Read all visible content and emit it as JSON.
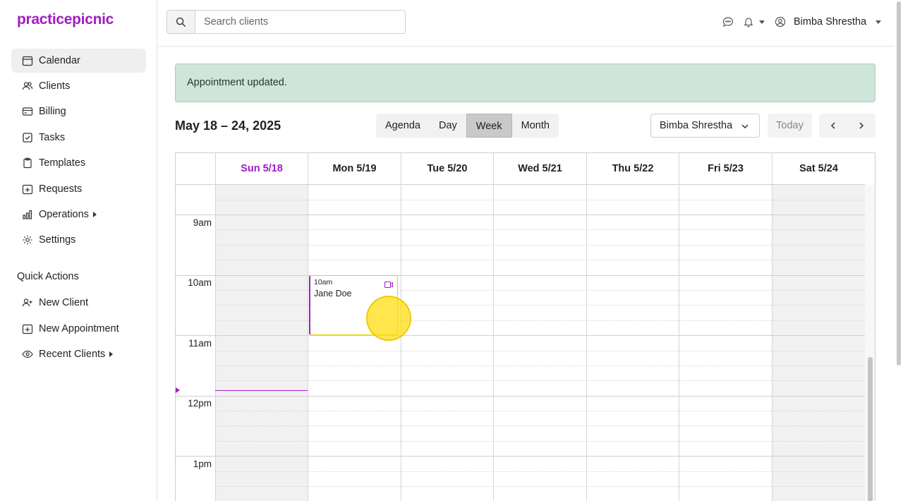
{
  "app": {
    "logo": "practicepicnic",
    "accent_color": "#a21cc2"
  },
  "sidebar": {
    "items": [
      {
        "label": "Calendar",
        "icon": "calendar-icon",
        "active": true
      },
      {
        "label": "Clients",
        "icon": "users-icon"
      },
      {
        "label": "Billing",
        "icon": "credit-card-icon"
      },
      {
        "label": "Tasks",
        "icon": "checkbox-icon"
      },
      {
        "label": "Templates",
        "icon": "clipboard-icon"
      },
      {
        "label": "Requests",
        "icon": "calendar-plus-icon"
      },
      {
        "label": "Operations",
        "icon": "bar-chart-icon",
        "expandable": true
      },
      {
        "label": "Settings",
        "icon": "gear-icon"
      }
    ],
    "quick_actions_title": "Quick Actions",
    "quick_actions": [
      {
        "label": "New Client",
        "icon": "user-plus-icon"
      },
      {
        "label": "New Appointment",
        "icon": "calendar-plus-icon"
      },
      {
        "label": "Recent Clients",
        "icon": "eye-icon",
        "expandable": true
      }
    ]
  },
  "header": {
    "search_placeholder": "Search clients",
    "user_name": "Bimba Shrestha"
  },
  "alert": {
    "message": "Appointment updated."
  },
  "toolbar": {
    "range_title": "May 18 – 24, 2025",
    "views": [
      "Agenda",
      "Day",
      "Week",
      "Month"
    ],
    "active_view": "Week",
    "provider": "Bimba Shrestha",
    "today_label": "Today"
  },
  "calendar": {
    "days": [
      {
        "label": "Sun 5/18",
        "today": true,
        "weekend": true
      },
      {
        "label": "Mon 5/19"
      },
      {
        "label": "Tue 5/20"
      },
      {
        "label": "Wed 5/21"
      },
      {
        "label": "Thu 5/22"
      },
      {
        "label": "Fri 5/23"
      },
      {
        "label": "Sat 5/24",
        "weekend": true
      }
    ],
    "hours": [
      "9am",
      "10am",
      "11am",
      "12pm",
      "1pm"
    ],
    "events": [
      {
        "day": "Mon 5/19",
        "time": "10am",
        "title": "Jane Doe",
        "icon": "video-icon"
      }
    ]
  }
}
